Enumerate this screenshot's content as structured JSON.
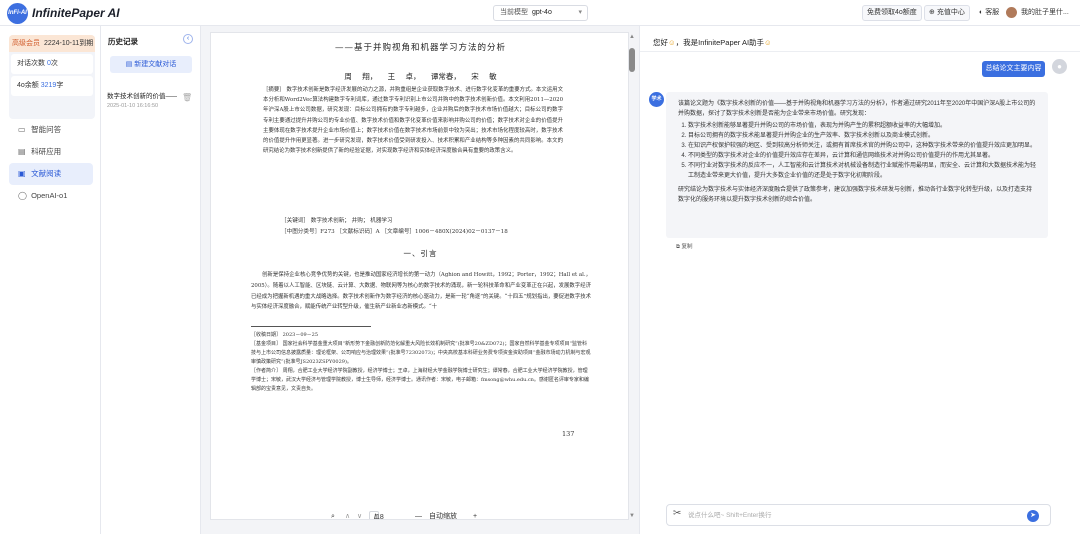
{
  "app": {
    "logo_text": "InFi-AI",
    "brand": "InfinitePaper AI"
  },
  "topbar": {
    "model_label": "当前模型",
    "model_value": "gpt-4o",
    "free_quota": "免费领取4o额度",
    "recharge": "充值中心",
    "service": "客服",
    "user_name": "我的肚子里什..."
  },
  "member": {
    "badge": "高级会员",
    "expiry": "2224-10-11到期",
    "chat_count_label": "对话次数",
    "chat_count_value": "0",
    "chat_count_unit": "次",
    "balance_label": "4o余额",
    "balance_value": "3219",
    "balance_unit": "字"
  },
  "nav": {
    "items": [
      {
        "label": "智能问答",
        "icon": "chat-icon"
      },
      {
        "label": "科研应用",
        "icon": "document-icon"
      },
      {
        "label": "文献阅读",
        "icon": "book-icon",
        "active": true
      },
      {
        "label": "OpenAI-o1",
        "icon": "circle-icon"
      }
    ]
  },
  "history": {
    "title": "历史记录",
    "collapse_icon": "chevron-left-icon",
    "new_button": "新建文献对话",
    "items": [
      {
        "name": "数字技术创新的价值——...",
        "time": "2025-01-10 16:16:50"
      }
    ]
  },
  "doc": {
    "subtitle": "——基于并购视角和机器学习方法的分析",
    "authors": "周 翔， 王 卓， 谭常春， 宋 敏",
    "abstract": "［摘要］ 数字技术创新是数字经济发展的动力之源，并购重组是企业获取数字技术、进行数字化变革的重要方式。本文运用文本分析和Word2Vec算法构建数字专利词库，通过数字专利识别上市公司并购中的数字技术创新价值。本文利用2011—2020年沪深A股上市公司数据，研究发现：目标公司拥有的数字专利越多，企业并购后的数字技术市场价值越大；目标公司的数字专利主要通过提升并购公司的专业价值、数字技术价值和数字化变革价值来影响并购公司的价值；数字技术对企业的价值提升主要体现在数字技术提升企业市场价值上；数字技术价值在数字技术市场前景中较为突出；技术市场化程度较高时，数字技术的价值提升作用更显著。进一步研究发现，数字技术价值受到研发投入、技术积累和产业结构等多种因素的共同影响。本文的研究结论为数字技术创新提供了新的经验证据，对实现数字经济和实体经济深度融合具有重要的政策含义。",
    "keywords": "［关键词］ 数字技术创新； 并购； 机器学习",
    "classification": "［中图分类号］F273 ［文献标识码］A ［文章编号］1006－480X(2024)02－0137－18",
    "section_heading": "一、引言",
    "body": "创新是保持企业核心竞争优势的关键，也是推动国家经济增长的第一动力（Aghion and Howitt，1992；Porter，1992；Hall et al.，2005）。随着以人工智能、区块链、云计算、大数据、物联网等为核心的数字技术的涌现，新一轮科技革命和产业变革正在兴起，发展数字经济已经成为把握新机遇的重大战略选择。数字技术创新作为数字经济的核心驱动力，是新一轮“角逐”的关键。“十四五”规划指出，要促进数字技术与实体经济深度融合，赋能传统产业转型升级，催生新产业新业态新模式。“十",
    "footnote_received": "［收稿日期］ 2023－09－25",
    "footnote_fund": "［基金项目］ 国家社会科学基金重大项目“新形势下金融创新防范化解重大风险长效机制研究”(批准号20&ZD072)；国家自然科学基金专项项目“监管科技与上市公司信息披露质量：理论框架、公司响应与治理效果”(批准号72302073)；中央高校基本科研业务费专项资金资助项目“金融市场动力机制与宏观审慎政策研究”(批准号JS2023ZSPY0029)。",
    "footnote_author": "［作者简介］ 周翔，合肥工业大学经济学院副教授，经济学博士；王卓，上海财经大学金融学院博士研究生；谭常春，合肥工业大学经济学院教授，管理学博士；宋敏，武汉大学经济与管理学院教授，博士生导师，经济学博士。通讯作者：宋敏，电子邮箱：fmsong@whu.edu.cn。感谢匿名评审专家和编辑部的宝贵意见，文责自负。",
    "page_number": "137",
    "toolbar": {
      "search_icon": "search-icon",
      "page_current": "1",
      "page_total": "/18",
      "zoom_label": "自动缩放"
    }
  },
  "chat": {
    "greeting": "您好",
    "greeting_rest": "，我是InfinitePaper AI助手",
    "user_message": "总结论文主要内容",
    "bot_avatar_text": "学术",
    "bot_intro": "该篇论文题为《数字技术创新的价值——基于并购视角和机器学习方法的分析》，作者通过研究2011年至2020年中国沪深A股上市公司的并购数据，探讨了数字技术创新是否能为企业带来市场价值。研究发现：",
    "bot_points": [
      "数字技术创新能够显著提升并购公司的市场价值，表现为并购产生的累积超额收益率的大幅增加。",
      "目标公司拥有的数字技术能显著提升并购企业的生产效率、数字技术创新以及商业模式创新。",
      "在知识产权保护较强的地区、受到较高分析师关注，或拥有首席技术官的并购公司中，这种数字技术带来的价值提升效应更加明显。",
      "不同类型的数字技术对企业的价值提升效应存在差异，云计算和通信网络技术对并购公司价值提升的作用尤其显著。",
      "不同行业对数字技术的反应不一，人工智能和云计算技术对机械设备制造行业赋能作用最明显，而安全、云计算和大数据技术能为轻工制造业带来更大价值，提升大多数企业价值的还是处于数字化初期阶段。"
    ],
    "bot_conclusion": "研究结论为数字技术与实体经济深度融合提供了政策参考，建议加强数字技术研发与创新，推动各行业数字化转型升级，以及打造支持数字化的服务环境以提升数字技术创新的综合价值。",
    "copy_label": "复制",
    "input_placeholder": "说点什么吧~ Shift+Enter换行",
    "input_value": ""
  }
}
